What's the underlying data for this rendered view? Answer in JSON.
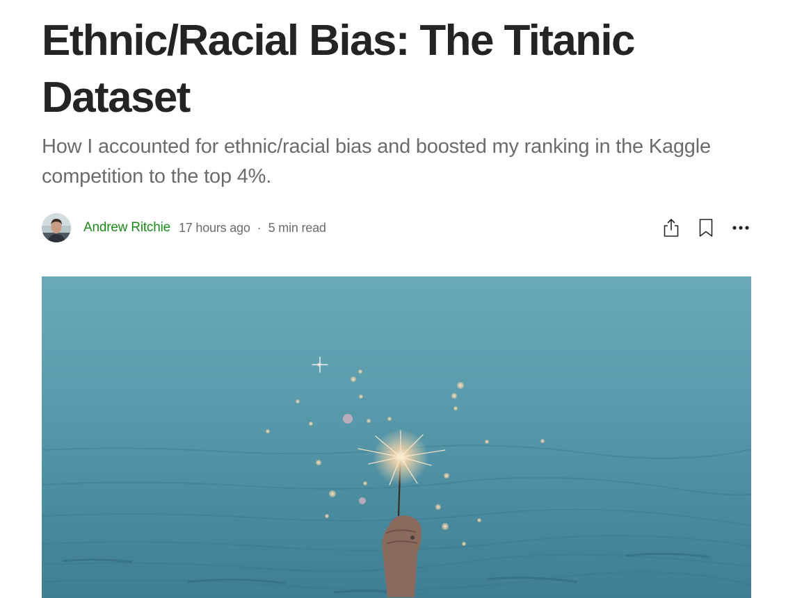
{
  "article": {
    "title": "Ethnic/Racial Bias: The Titanic Dataset",
    "subtitle": "How I accounted for ethnic/racial bias and boosted my ranking in the Kaggle competition to the top 4%."
  },
  "byline": {
    "author": "Andrew Ritchie",
    "posted": "17 hours ago",
    "separator": "·",
    "read_time": "5 min read"
  },
  "actions": {
    "share_icon": "share-icon",
    "bookmark_icon": "bookmark-icon",
    "more_icon": "more-icon"
  },
  "hero_image": {
    "description_icon": "ocean-sparkler-image"
  },
  "colors": {
    "author_link": "#1a8917",
    "text_primary": "#242424",
    "text_secondary": "#6b6b6b"
  }
}
